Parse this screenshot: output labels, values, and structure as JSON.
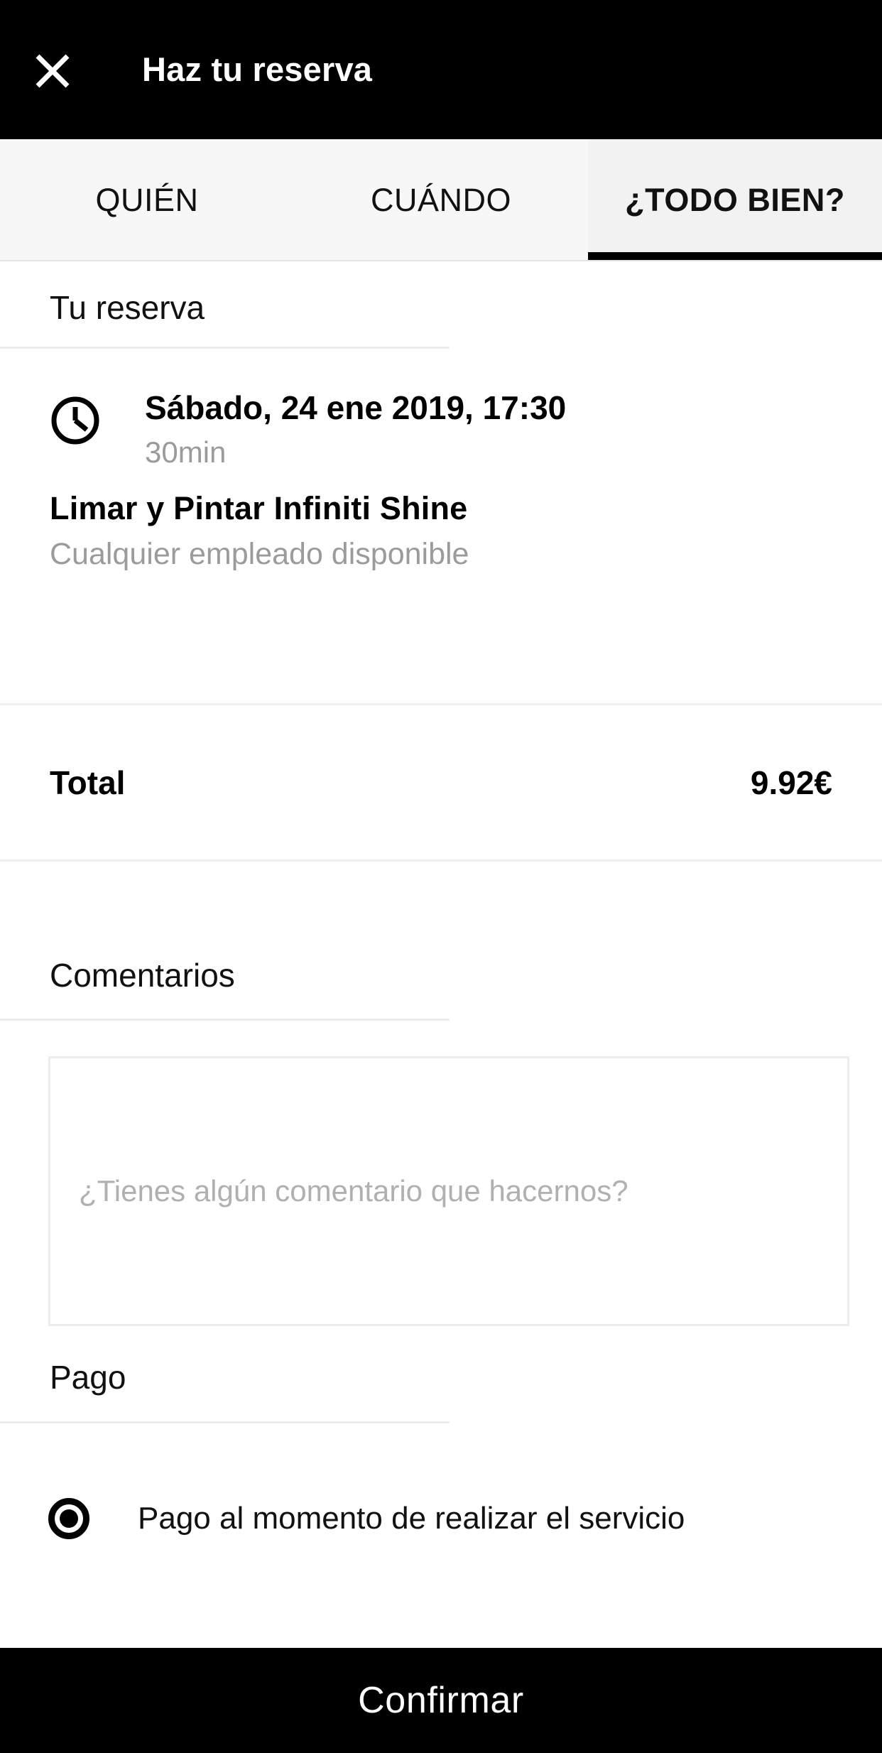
{
  "appbar": {
    "title": "Haz tu reserva",
    "close_icon": "close-icon"
  },
  "tabs": [
    {
      "label": "QUIÉN",
      "active": false
    },
    {
      "label": "CUÁNDO",
      "active": false
    },
    {
      "label": "¿TODO BIEN?",
      "active": true
    }
  ],
  "booking": {
    "section_title": "Tu reserva",
    "clock_icon": "clock-icon",
    "datetime": "Sábado, 24 ene 2019, 17:30",
    "duration": "30min",
    "service_name": "Limar y Pintar Infiniti Shine",
    "staff": "Cualquier empleado disponible"
  },
  "total": {
    "label": "Total",
    "value": "9.92€"
  },
  "comments": {
    "section_title": "Comentarios",
    "placeholder": "¿Tienes algún comentario que hacernos?",
    "value": ""
  },
  "payment": {
    "section_title": "Pago",
    "options": [
      {
        "label": "Pago al momento de realizar el servicio",
        "selected": true
      }
    ]
  },
  "footer": {
    "confirm_label": "Confirmar"
  },
  "colors": {
    "bar_background": "#000000",
    "bar_text": "#ffffff",
    "tabbar_background": "#f7f7f7",
    "active_tab_underline": "#000000",
    "muted_text": "#9b9b9b",
    "placeholder_text": "#b0b0b0",
    "divider": "#ececec"
  }
}
